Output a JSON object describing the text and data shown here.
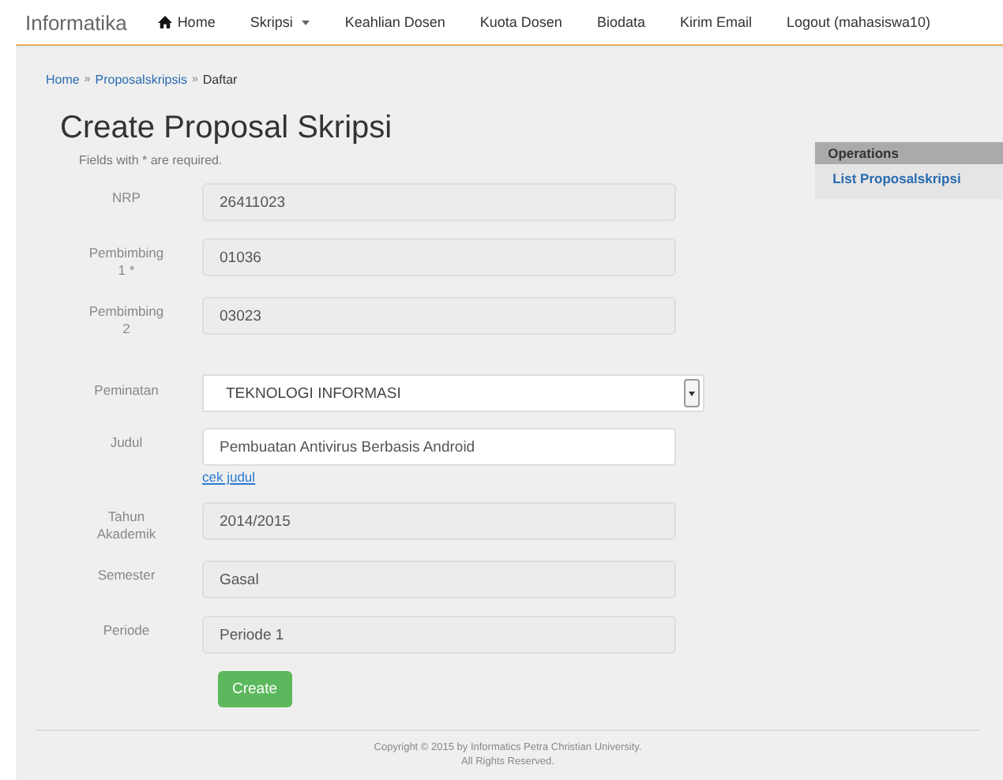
{
  "navbar": {
    "brand": "Informatika",
    "items": [
      {
        "label": "Home",
        "kind": "home"
      },
      {
        "label": "Skripsi",
        "kind": "dropdown"
      },
      {
        "label": "Keahlian Dosen",
        "kind": "link"
      },
      {
        "label": "Kuota Dosen",
        "kind": "link"
      },
      {
        "label": "Biodata",
        "kind": "link"
      },
      {
        "label": "Kirim Email",
        "kind": "link"
      },
      {
        "label": "Logout (mahasiswa10)",
        "kind": "link"
      }
    ]
  },
  "breadcrumb": {
    "links": [
      "Home",
      "Proposalskripsis"
    ],
    "current": "Daftar",
    "separator": "»"
  },
  "title": "Create Proposal Skripsi",
  "note": "Fields with * are required.",
  "fields": [
    {
      "kind": "text",
      "label": "NRP",
      "value": "26411023",
      "disabled": true
    },
    {
      "kind": "text",
      "label": "Pembimbing 1 *",
      "value": "01036",
      "disabled": true
    },
    {
      "kind": "text",
      "label": "Pembimbing 2",
      "value": "03023",
      "disabled": true
    },
    {
      "kind": "select",
      "label": "Peminatan",
      "value": "TEKNOLOGI INFORMASI"
    },
    {
      "kind": "text",
      "label": "Judul",
      "value": "Pembuatan Antivirus Berbasis Android",
      "disabled": false,
      "link": "cek judul"
    },
    {
      "kind": "text",
      "label": "Tahun Akademik",
      "value": "2014/2015",
      "disabled": true
    },
    {
      "kind": "text",
      "label": "Semester",
      "value": "Gasal",
      "disabled": true
    },
    {
      "kind": "text",
      "label": "Periode",
      "value": "Periode 1",
      "disabled": true
    }
  ],
  "submit": "Create",
  "sidebar": {
    "title": "Operations",
    "items": [
      "List Proposalskripsi"
    ]
  },
  "footer": [
    "Copyright © 2015 by Informatics Petra Christian University.",
    "All Rights Reserved."
  ]
}
